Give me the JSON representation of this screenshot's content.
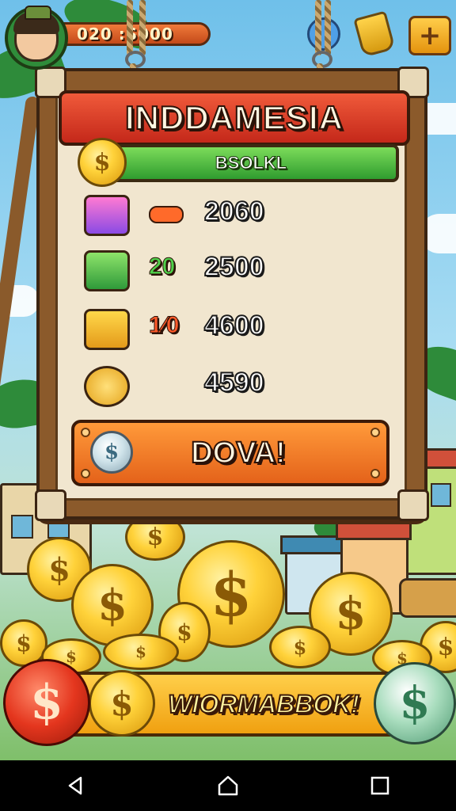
{
  "top_bar": {
    "stat_text": "020 :S000",
    "plus_label": "+"
  },
  "board": {
    "title": "INDDAMESIA",
    "progress_label": "BSOLKL",
    "rows": [
      {
        "icon": "gift-box-icon",
        "bonus": "",
        "value": "2060",
        "bonus_color": "#ff6a2a"
      },
      {
        "icon": "cash-stack-icon",
        "bonus": "20",
        "value": "2500",
        "bonus_color": "#4fd04a"
      },
      {
        "icon": "treasure-chest-icon",
        "bonus": "1⁄0",
        "value": "4600",
        "bonus_color": "#ff5a2a"
      },
      {
        "icon": "piggy-bank-icon",
        "bonus": "",
        "value": "4590",
        "bonus_color": "#ffffff"
      }
    ],
    "action_button": "DOVA!"
  },
  "bottom": {
    "banner_text": "WIORMABBOK!"
  },
  "coin_symbol": "$",
  "nav": {
    "back": "back-icon",
    "home": "home-icon",
    "recents": "recents-icon"
  }
}
